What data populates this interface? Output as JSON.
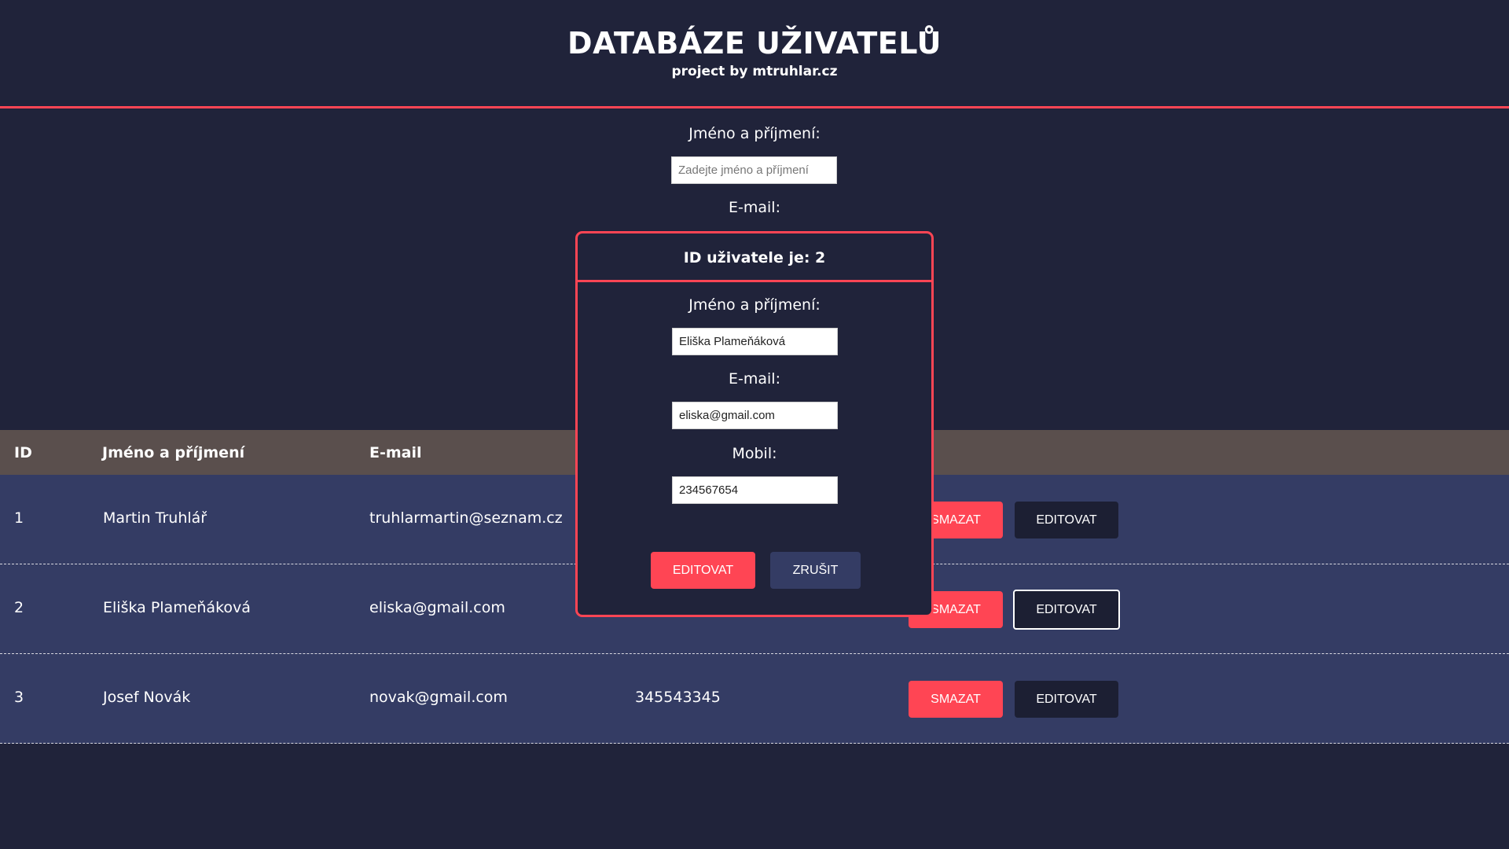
{
  "header": {
    "title": "DATABÁZE UŽIVATELŮ",
    "subtitle": "project by mtruhlar.cz"
  },
  "add_form": {
    "name_label": "Jméno a příjmení:",
    "name_placeholder": "Zadejte jméno a příjmení",
    "email_label": "E-mail:"
  },
  "table": {
    "headers": [
      "ID",
      "Jméno a příjmení",
      "E-mail"
    ],
    "rows": [
      {
        "id": "1",
        "name": "Martin Truhlář",
        "email": "truhlarmartin@seznam.cz",
        "phone": "",
        "delete_label": "SMAZAT",
        "edit_label": "EDITOVAT"
      },
      {
        "id": "2",
        "name": "Eliška Plameňáková",
        "email": "eliska@gmail.com",
        "phone": "",
        "delete_label": "SMAZAT",
        "edit_label": "EDITOVAT"
      },
      {
        "id": "3",
        "name": "Josef Novák",
        "email": "novak@gmail.com",
        "phone": "345543345",
        "delete_label": "SMAZAT",
        "edit_label": "EDITOVAT"
      }
    ]
  },
  "modal": {
    "title": "ID uživatele je: 2",
    "name_label": "Jméno a příjmení:",
    "name_value": "Eliška Plameňáková",
    "email_label": "E-mail:",
    "email_value": "eliska@gmail.com",
    "phone_label": "Mobil:",
    "phone_value": "234567654",
    "edit_button": "EDITOVAT",
    "cancel_button": "ZRUŠIT"
  },
  "colors": {
    "background": "#20233a",
    "accent": "#ff4554",
    "row_background": "#343c64",
    "table_header": "#5a4f4d",
    "dark_button": "#1c1f33"
  }
}
